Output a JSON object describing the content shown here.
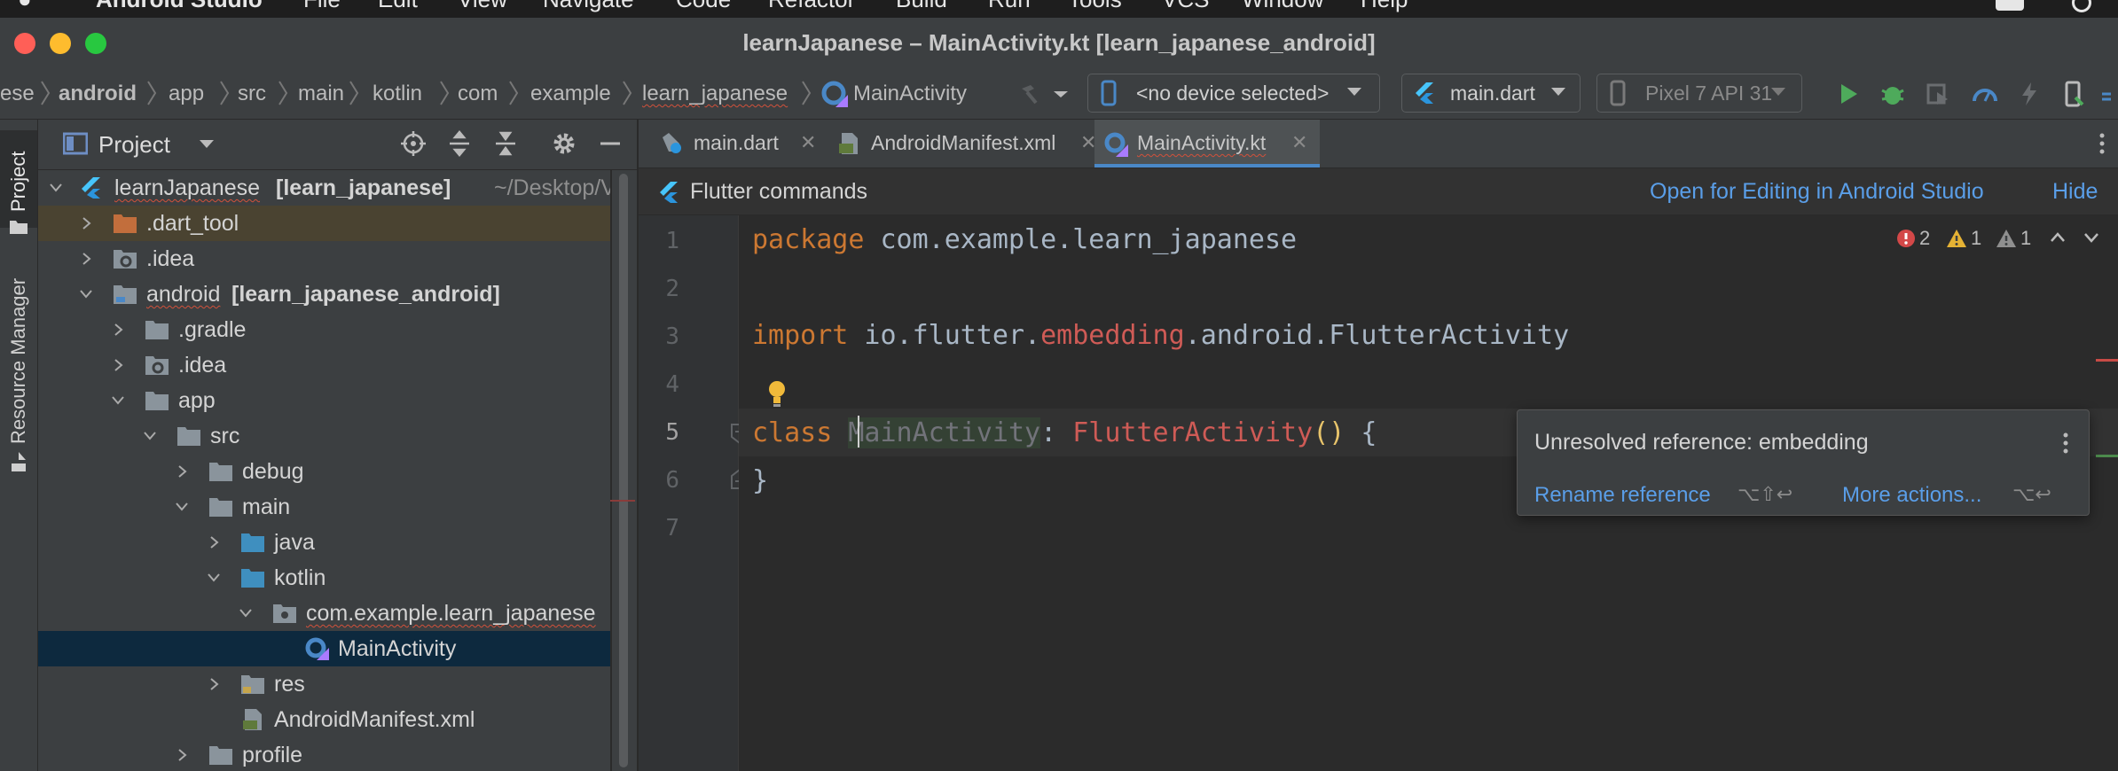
{
  "menubar": {
    "items": [
      "Android Studio",
      "File",
      "Edit",
      "View",
      "Navigate",
      "Code",
      "Refactor",
      "Build",
      "Run",
      "Tools",
      "VCS",
      "Window",
      "Help"
    ]
  },
  "window": {
    "title": "learnJapanese – MainActivity.kt [learn_japanese_android]"
  },
  "breadcrumb": [
    "ese",
    "android",
    "app",
    "src",
    "main",
    "kotlin",
    "com",
    "example",
    "learn_japanese",
    "MainActivity"
  ],
  "toolbar": {
    "device_selector": "<no device selected>",
    "run_config": "main.dart",
    "emulator": "Pixel 7 API 31"
  },
  "stripe": {
    "project": "Project",
    "resource_manager": "Resource Manager"
  },
  "project_panel": {
    "title": "Project",
    "tree": [
      {
        "label": "learnJapanese",
        "module": "[learn_japanese]",
        "path": "~/Desktop/V"
      },
      {
        "label": ".dart_tool"
      },
      {
        "label": ".idea"
      },
      {
        "label": "android",
        "module": "[learn_japanese_android]"
      },
      {
        "label": ".gradle"
      },
      {
        "label": ".idea"
      },
      {
        "label": "app"
      },
      {
        "label": "src"
      },
      {
        "label": "debug"
      },
      {
        "label": "main"
      },
      {
        "label": "java"
      },
      {
        "label": "kotlin"
      },
      {
        "label": "com.example.learn_japanese"
      },
      {
        "label": "MainActivity"
      },
      {
        "label": "res"
      },
      {
        "label": "AndroidManifest.xml"
      },
      {
        "label": "profile"
      }
    ]
  },
  "tabs": [
    {
      "label": "main.dart"
    },
    {
      "label": "AndroidManifest.xml"
    },
    {
      "label": "MainActivity.kt"
    }
  ],
  "flutter_bar": {
    "label": "Flutter commands",
    "open_link": "Open for Editing in Android Studio",
    "hide_link": "Hide"
  },
  "inspections": {
    "errors": "2",
    "warnings": "1",
    "weak_warnings": "1"
  },
  "editor": {
    "line_numbers": [
      "1",
      "2",
      "3",
      "4",
      "5",
      "6",
      "7"
    ],
    "l1_kw": "package",
    "l1_rest": " com.example.learn_japanese",
    "l3_kw": "import",
    "l3_a": " io.flutter.",
    "l3_err": "embedding",
    "l3_b": ".android.FlutterActivity",
    "l5_kw": "class",
    "l5_name": "MainActivity",
    "l5_colon": ": ",
    "l5_super": "FlutterActivity",
    "l5_parens": "()",
    "l5_brace": " {",
    "l6_brace": "}"
  },
  "popup": {
    "message": "Unresolved reference: embedding",
    "action1": "Rename reference",
    "shortcut1": "⌥⇧↩",
    "action2": "More actions...",
    "shortcut2": "⌥↩"
  },
  "colors": {
    "accent": "#4a88c7",
    "error": "#cf5b56",
    "keyword": "#cc7832",
    "link": "#5a9ee8",
    "folder": "#8a949c",
    "run_green": "#4eaa5b"
  }
}
